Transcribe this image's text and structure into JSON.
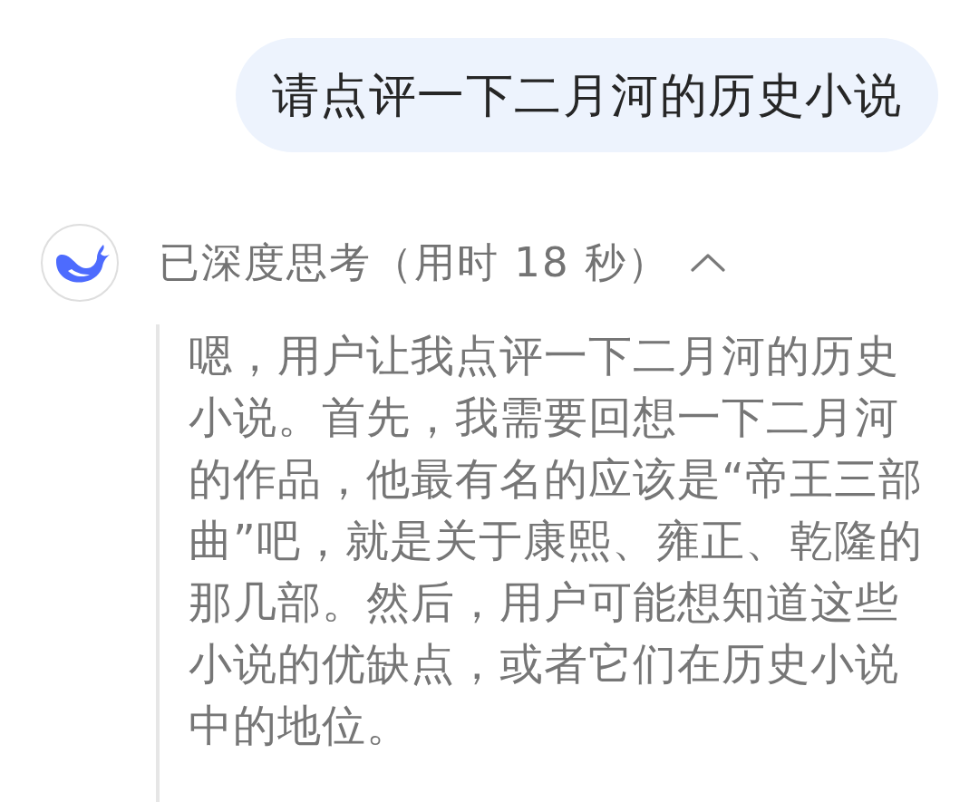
{
  "user_message": {
    "text": "请点评一下二月河的历史小说"
  },
  "assistant": {
    "thinking": {
      "label": "已深度思考（用时 18 秒）",
      "expanded": true,
      "text": "嗯，用户让我点评一下二月河的历史小说。首先，我需要回想一下二月河的作品，他最有名的应该是“帝王三部曲”吧，就是关于康熙、雍正、乾隆的那几部。然后，用户可能想知道这些小说的优缺点，或者它们在历史小说中的地位。"
    }
  }
}
